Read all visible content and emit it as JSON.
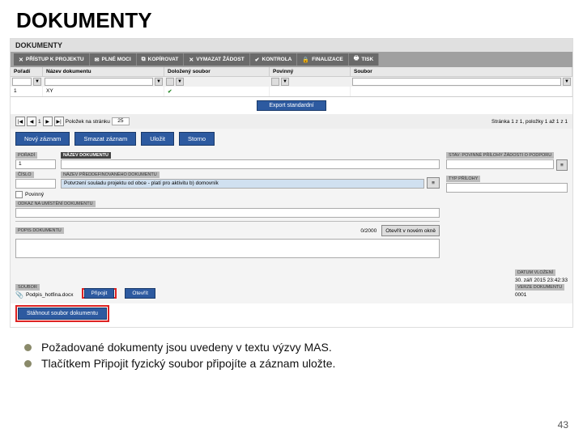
{
  "slide": {
    "title": "DOKUMENTY",
    "pagenum": "43"
  },
  "app": {
    "heading": "DOKUMENTY",
    "toolbar": [
      {
        "icon": "✕",
        "label": "PŘÍSTUP K PROJEKTU"
      },
      {
        "icon": "✉",
        "label": "PLNÉ MOCI"
      },
      {
        "icon": "⧉",
        "label": "KOPÍROVAT"
      },
      {
        "icon": "✕",
        "label": "VYMAZAT ŽÁDOST"
      },
      {
        "icon": "✔",
        "label": "KONTROLA"
      },
      {
        "icon": "🔒",
        "label": "FINALIZACE"
      },
      {
        "icon": "🖶",
        "label": "TISK"
      }
    ],
    "columns": {
      "c1": "Pořadí",
      "c2": "Název dokumentu",
      "c3": "Doložený soubor",
      "c4": "Povinný",
      "c5": "Soubor"
    },
    "row": {
      "poradi": "1",
      "nazev": "XY"
    },
    "export_btn": "Export standardní",
    "pager": {
      "per_page_label": "Položek na stránku",
      "per_page_val": "25",
      "summary": "Stránka 1 z 1, položky 1 až 1 z 1"
    },
    "actions": {
      "novy": "Nový záznam",
      "smazat": "Smazat záznam",
      "ulozit": "Uložit",
      "storno": "Storno"
    },
    "form": {
      "poradi_label": "POŘADÍ",
      "poradi_val": "1",
      "nazev_label": "NÁZEV DOKUMENTU",
      "nazev_val": "",
      "cislo_label": "ČÍSLO",
      "preddef_label": "NÁZEV PŘEDDEFINOVANÉHO DOKUMENTU",
      "preddef_val": "Potvrzení souladu projektu od obce - platí pro aktivitu b) domovník",
      "povinne_label": "STAV: POVINNÉ PŘÍLOHY ŽÁDOSTI O PODPORU",
      "odkaz_label": "ODKAZ NA UMÍSTĚNÍ DOKUMENTU",
      "typ_label": "TYP PŘÍLOHY",
      "povinny_check": "Povinný",
      "popis_label": "POPIS DOKUMENTU",
      "chars": "0/2000",
      "open_btn": "Otevřít v novém okně"
    },
    "footer": {
      "soubor_label": "SOUBOR",
      "soubor_val": "Podpis_hotfina.docx",
      "pripojit": "Připojit",
      "otevrit": "Otevřít",
      "datum_label": "DATUM VLOŽENÍ",
      "datum_val": "30. září 2015 23:42:33",
      "verze_label": "VERZE DOKUMENTU",
      "verze_val": "0001",
      "download": "Stáhnout soubor dokumentu"
    }
  },
  "bullets": {
    "b1": "Požadované dokumenty jsou uvedeny v textu výzvy MAS.",
    "b2": "Tlačítkem Připojit fyzický soubor připojíte a záznam uložte."
  }
}
